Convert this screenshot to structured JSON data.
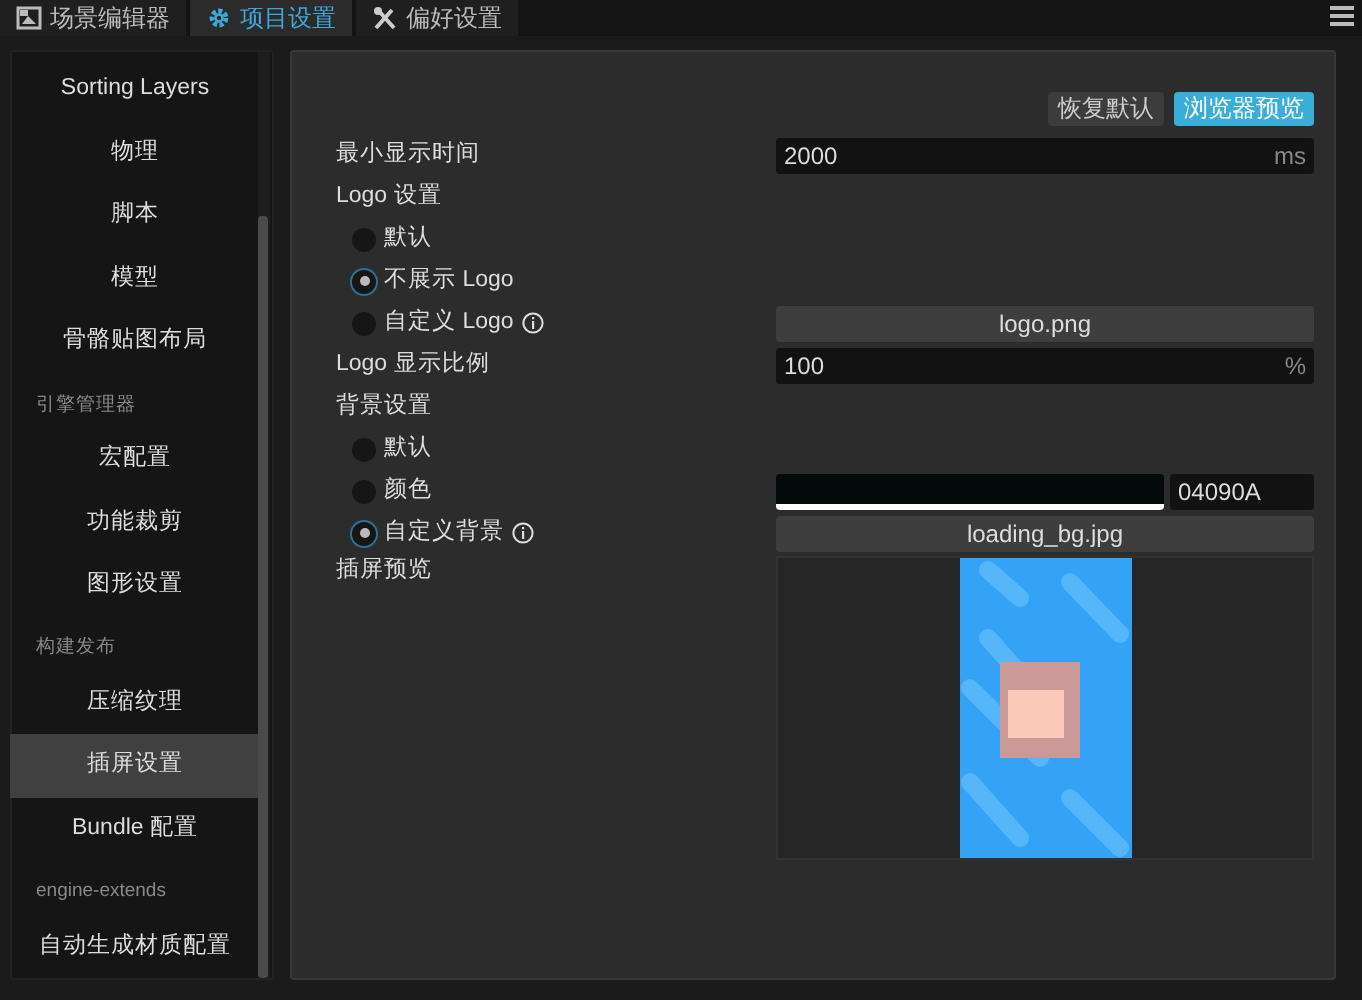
{
  "tabs": [
    {
      "kind": "scene",
      "label": "场景编辑器",
      "selected": false
    },
    {
      "kind": "gear",
      "label": "项目设置",
      "selected": true
    },
    {
      "kind": "tools",
      "label": "偏好设置",
      "selected": false
    }
  ],
  "sidebar": {
    "items": [
      {
        "kind": "item",
        "label": "Sorting Layers",
        "selected": false
      },
      {
        "kind": "item",
        "label": "物理",
        "selected": false
      },
      {
        "kind": "item",
        "label": "脚本",
        "selected": false
      },
      {
        "kind": "item",
        "label": "模型",
        "selected": false
      },
      {
        "kind": "item",
        "label": "骨骼贴图布局",
        "selected": false
      },
      {
        "kind": "group",
        "label": "引擎管理器"
      },
      {
        "kind": "item",
        "label": "宏配置",
        "selected": false
      },
      {
        "kind": "item",
        "label": "功能裁剪",
        "selected": false
      },
      {
        "kind": "item",
        "label": "图形设置",
        "selected": false
      },
      {
        "kind": "group",
        "label": "构建发布"
      },
      {
        "kind": "item",
        "label": "压缩纹理",
        "selected": false
      },
      {
        "kind": "item",
        "label": "插屏设置",
        "selected": true
      },
      {
        "kind": "item",
        "label": "Bundle 配置",
        "selected": false
      },
      {
        "kind": "group",
        "label": "engine-extends"
      },
      {
        "kind": "item",
        "label": "自动生成材质配置",
        "selected": false
      }
    ]
  },
  "buttons": [
    {
      "kind": "secondary",
      "label": "恢复默认"
    },
    {
      "kind": "primary",
      "label": "浏览器预览"
    }
  ],
  "settings": [
    {
      "kind": "input",
      "label": "最小显示时间",
      "value": "2000",
      "unit": "ms"
    },
    {
      "kind": "heading",
      "label": "Logo 设置"
    },
    {
      "kind": "radio",
      "label": "默认",
      "selected": false,
      "info": false
    },
    {
      "kind": "radio",
      "label": "不展示 Logo",
      "selected": true,
      "info": false
    },
    {
      "kind": "radio",
      "label": "自定义 Logo",
      "selected": false,
      "info": true,
      "file": "logo.png"
    },
    {
      "kind": "input",
      "label": "Logo 显示比例",
      "value": "100",
      "unit": "%"
    },
    {
      "kind": "heading",
      "label": "背景设置"
    },
    {
      "kind": "radio",
      "label": "默认",
      "selected": false,
      "info": false
    },
    {
      "kind": "radio",
      "label": "颜色",
      "selected": false,
      "info": false,
      "color": "#04090a",
      "hex": "04090A"
    },
    {
      "kind": "radio",
      "label": "自定义背景",
      "selected": true,
      "info": true,
      "file": "loading_bg.jpg"
    },
    {
      "kind": "preview",
      "label": "插屏预览"
    }
  ]
}
